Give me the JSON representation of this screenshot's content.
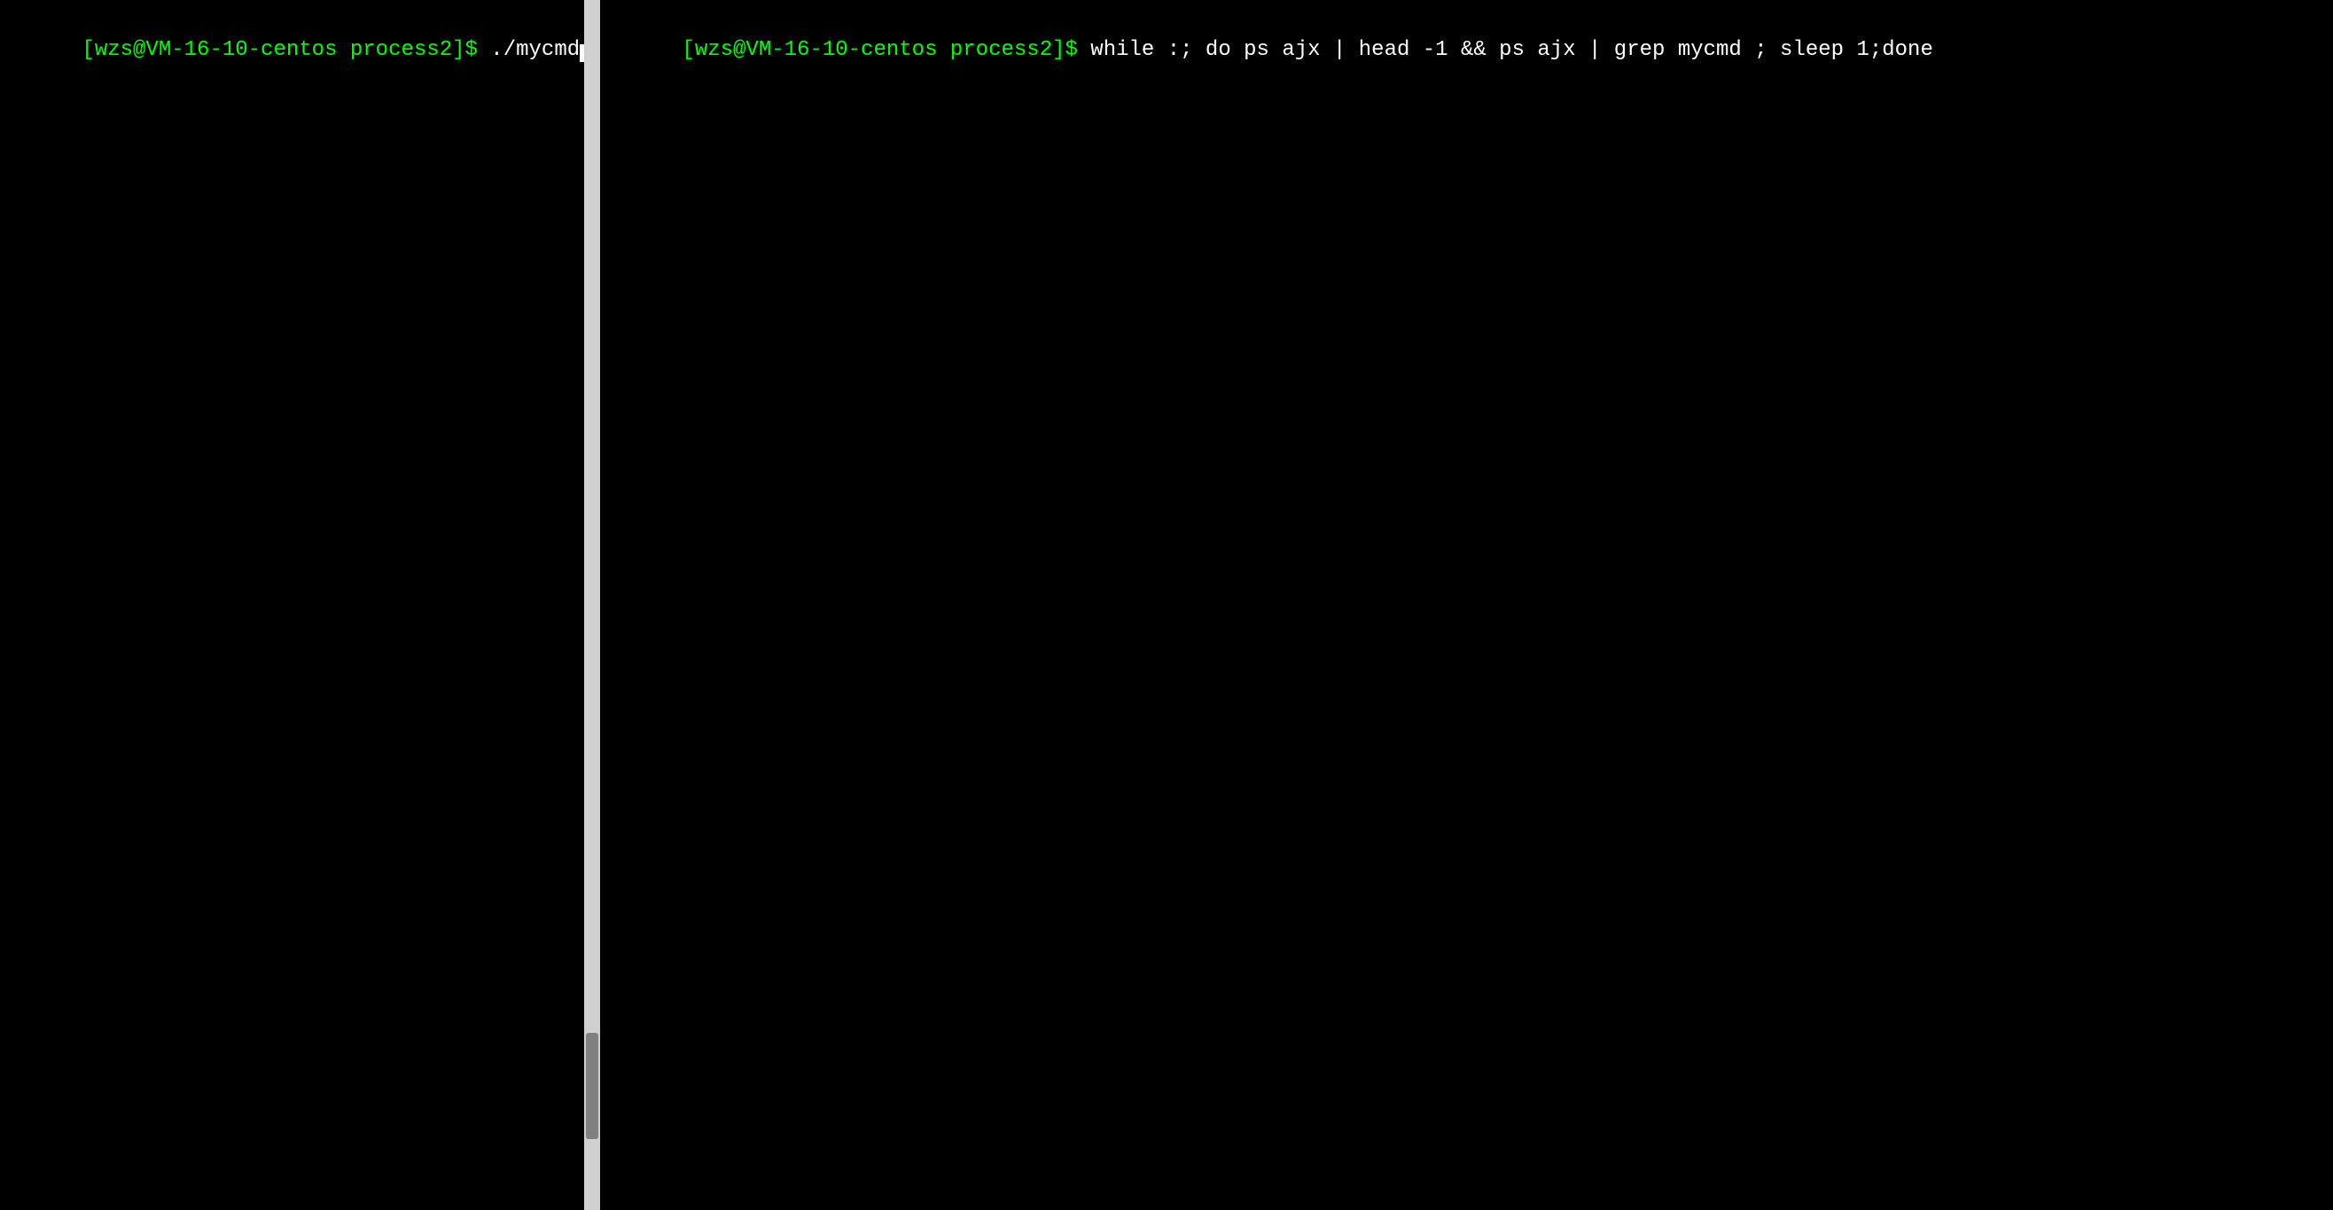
{
  "left_pane": {
    "prompt": "[wzs@VM-16-10-centos process2]$",
    "command": " ./mycmd",
    "has_cursor": true
  },
  "right_pane": {
    "prompt": "[wzs@VM-16-10-centos process2]$",
    "command": " while :; do ps ajx | head -1 && ps ajx | grep mycmd ; sleep 1;done"
  },
  "divider": {
    "handle_color": "#808080",
    "bg_color": "#d0d0d0"
  }
}
